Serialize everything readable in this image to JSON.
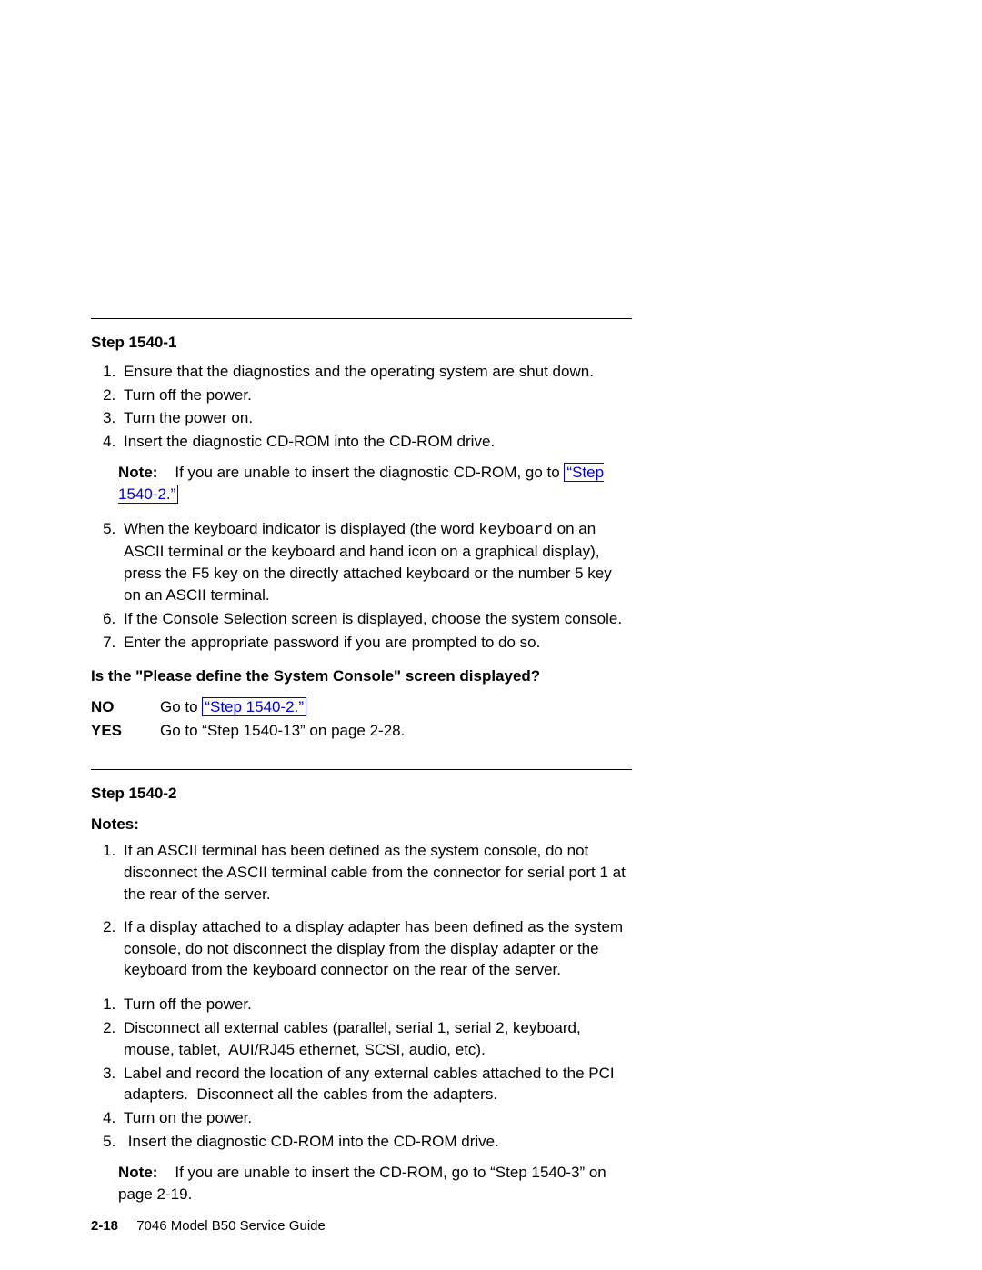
{
  "step1": {
    "title": "Step 1540-1",
    "items": [
      "Ensure that the diagnostics and the operating system are shut down.",
      "Turn off the power.",
      "Turn the power on.",
      "Insert the diagnostic CD-ROM into the CD-ROM drive."
    ],
    "note_prefix": "Note:",
    "note_body_a": "If you are unable to insert the diagnostic CD-ROM, go to ",
    "note_link": "“Step 1540-2.”",
    "item5_a": "When the keyboard indicator is displayed (the word ",
    "item5_kw": "keyboard",
    "item5_b": " on an ASCII terminal or the keyboard and hand icon on a graphical display), press the F5 key on the directly attached keyboard or the number 5 key on an ASCII terminal.",
    "item6": "If the Console Selection screen is displayed, choose the system console.",
    "item7": "Enter the appropriate password if you are prompted to do so.",
    "question": "Is the \"Please define the System Console\" screen displayed?",
    "no_label": "NO",
    "no_a": "Go to ",
    "no_link": "“Step 1540-2.”",
    "yes_label": "YES",
    "yes_text": "Go to “Step 1540-13” on page 2-28."
  },
  "step2": {
    "title": "Step 1540-2",
    "notes_head": "Notes:",
    "notes": [
      "If an ASCII terminal has been defined as the system console, do not disconnect the ASCII terminal cable from the connector for serial port 1 at the rear of the server.",
      "If a display attached to a display adapter has been defined as the system console, do not disconnect the display from the display adapter or the keyboard from the keyboard connector on the rear of the server."
    ],
    "steps": [
      "Turn off the power.",
      "Disconnect all external cables (parallel, serial 1, serial 2, keyboard, mouse, tablet,  AUI/RJ45 ethernet, SCSI, audio, etc).",
      "Label and record the location of any external cables attached to the PCI adapters.  Disconnect all the cables from the adapters.",
      "Turn on the power.",
      " Insert the diagnostic CD-ROM into the CD-ROM drive."
    ],
    "note_prefix": "Note:",
    "note_body": "If you are unable to insert the CD-ROM, go to “Step 1540-3” on page 2-19."
  },
  "footer": {
    "page": "2-18",
    "title": "7046 Model B50 Service Guide"
  }
}
